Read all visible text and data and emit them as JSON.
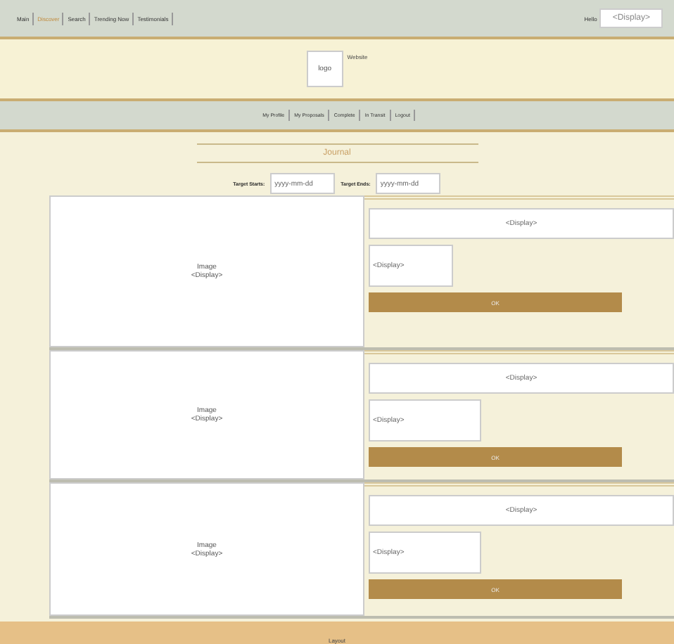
{
  "top_nav": {
    "tabs": [
      {
        "label": "Main",
        "selected": false
      },
      {
        "label": "Discover",
        "selected": true
      },
      {
        "label": "Search",
        "selected": false
      },
      {
        "label": "Trending Now",
        "selected": false
      },
      {
        "label": "Testimonials",
        "selected": false
      }
    ],
    "user_label": "Hello",
    "user_value": "<Display>"
  },
  "header": {
    "logo": "logo",
    "site_name": "Website"
  },
  "sub_nav": [
    "My Profile",
    "My Proposals",
    "Complete",
    "In Transit",
    "Logout"
  ],
  "section_title": "Journal",
  "filters": [
    {
      "label": "Target Starts:",
      "placeholder": "yyyy-mm-dd"
    },
    {
      "label": "Target Ends:",
      "placeholder": "yyyy-mm-dd"
    }
  ],
  "cards": [
    {
      "image_label": "Image",
      "image_value": "<Display>",
      "title": "<Display>",
      "detail": "<Display>",
      "button": "OK"
    },
    {
      "image_label": "Image",
      "image_value": "<Display>",
      "title": "<Display>",
      "detail": "<Display>",
      "button": "OK"
    },
    {
      "image_label": "Image",
      "image_value": "<Display>",
      "title": "<Display>",
      "detail": "<Display>",
      "button": "OK"
    }
  ],
  "footer": "Layout"
}
